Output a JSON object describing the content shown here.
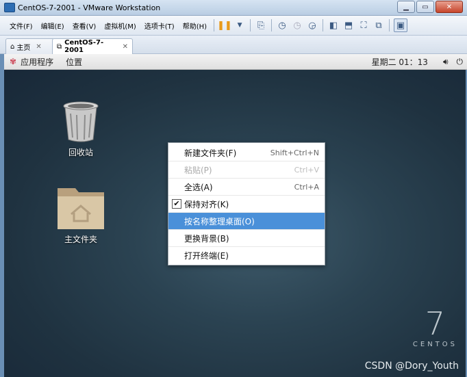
{
  "window": {
    "title": "CentOS-7-2001 - VMware Workstation"
  },
  "menu": [
    "文件(F)",
    "编辑(E)",
    "查看(V)",
    "虚拟机(M)",
    "选项卡(T)",
    "帮助(H)"
  ],
  "tabs": [
    {
      "label": "主页"
    },
    {
      "label": "CentOS-7-2001"
    }
  ],
  "gnome_bar": {
    "apps": "应用程序",
    "places": "位置",
    "clock": "星期二 01：13"
  },
  "desktop_icons": {
    "trash": "回收站",
    "home": "主文件夹"
  },
  "context_menu": [
    {
      "label": "新建文件夹(F)",
      "accel": "Shift+Ctrl+N"
    },
    {
      "label": "粘贴(P)",
      "accel": "Ctrl+V",
      "disabled": true
    },
    {
      "label": "全选(A)",
      "accel": "Ctrl+A"
    },
    {
      "label": "保持对齐(K)",
      "accel": "",
      "checked": true
    },
    {
      "label": "按名称整理桌面(O)",
      "accel": "",
      "highlighted": true
    },
    {
      "label": "更换背景(B)",
      "accel": ""
    },
    {
      "label": "打开终端(E)",
      "accel": ""
    }
  ],
  "logo": {
    "number": "7",
    "word": "CENTOS"
  },
  "watermark": "CSDN @Dory_Youth",
  "colors": {
    "highlight": "#4a90d9",
    "desktop": "#2b4352"
  }
}
